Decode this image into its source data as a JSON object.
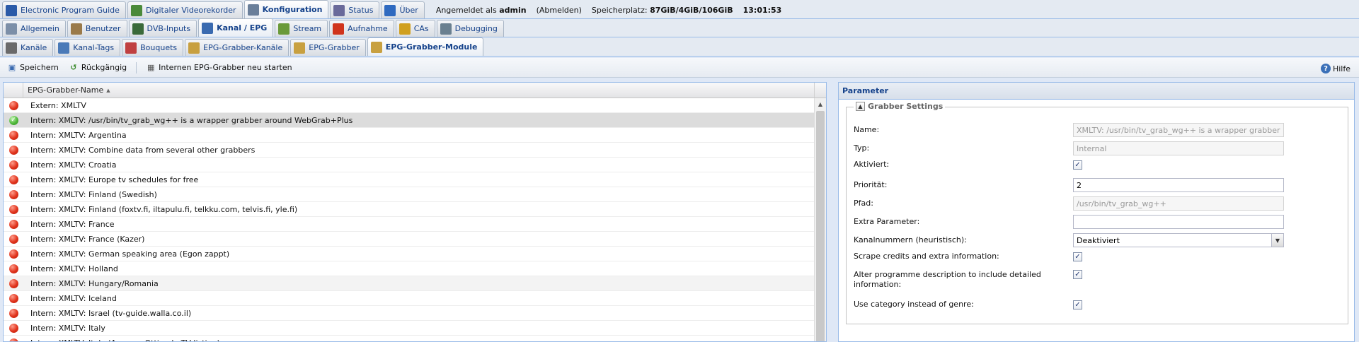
{
  "main_tabs": [
    {
      "label": "Electronic Program Guide",
      "icon": "epg-icon",
      "color": "#2a5aa8",
      "active": false
    },
    {
      "label": "Digitaler Videorekorder",
      "icon": "download-icon",
      "color": "#4a8a3a",
      "active": false
    },
    {
      "label": "Konfiguration",
      "icon": "wrench-icon",
      "color": "#6a7f9a",
      "active": true
    },
    {
      "label": "Status",
      "icon": "eye-icon",
      "color": "#6a6a9a",
      "active": false
    },
    {
      "label": "Über",
      "icon": "info-icon",
      "color": "#2f6ac0",
      "active": false
    }
  ],
  "header_info": {
    "logged_in_label": "Angemeldet als",
    "user": "admin",
    "logout": "(Abmelden)",
    "storage_label": "Speicherplatz:",
    "storage_value": "87GiB/4GiB/106GiB",
    "time": "13:01:53"
  },
  "config_tabs": [
    {
      "label": "Allgemein",
      "icon": "tools-icon",
      "color": "#7c8fa8"
    },
    {
      "label": "Benutzer",
      "icon": "user-icon",
      "color": "#9a7a4a"
    },
    {
      "label": "DVB-Inputs",
      "icon": "tv-card-icon",
      "color": "#3a6a3a"
    },
    {
      "label": "Kanal / EPG",
      "icon": "tv-icon",
      "color": "#3a6ab0",
      "active": true
    },
    {
      "label": "Stream",
      "icon": "stream-icon",
      "color": "#6a9a3a"
    },
    {
      "label": "Aufnahme",
      "icon": "record-icon",
      "color": "#d0341c"
    },
    {
      "label": "CAs",
      "icon": "key-icon",
      "color": "#d0a020"
    },
    {
      "label": "Debugging",
      "icon": "bug-icon",
      "color": "#6a8090"
    }
  ],
  "sub_tabs": [
    {
      "label": "Kanäle",
      "icon": "remote-icon",
      "color": "#6a6a6a"
    },
    {
      "label": "Kanal-Tags",
      "icon": "tags-icon",
      "color": "#4a7ab8"
    },
    {
      "label": "Bouquets",
      "icon": "bouquet-icon",
      "color": "#c04040"
    },
    {
      "label": "EPG-Grabber-Kanäle",
      "icon": "folder-icon",
      "color": "#c8a040"
    },
    {
      "label": "EPG-Grabber",
      "icon": "folder-icon",
      "color": "#c8a040"
    },
    {
      "label": "EPG-Grabber-Module",
      "icon": "folder-icon",
      "color": "#c8a040",
      "active": true
    }
  ],
  "toolbar": {
    "save": "Speichern",
    "undo": "Rückgängig",
    "restart": "Internen EPG-Grabber neu starten",
    "help": "Hilfe"
  },
  "grid": {
    "column": "EPG-Grabber-Name",
    "rows": [
      {
        "name": "Extern: XMLTV",
        "enabled": false
      },
      {
        "name": "Intern: XMLTV: /usr/bin/tv_grab_wg++ is a wrapper grabber around WebGrab+Plus",
        "enabled": true,
        "selected": true
      },
      {
        "name": "Intern: XMLTV: Argentina",
        "enabled": false
      },
      {
        "name": "Intern: XMLTV: Combine data from several other grabbers",
        "enabled": false
      },
      {
        "name": "Intern: XMLTV: Croatia",
        "enabled": false
      },
      {
        "name": "Intern: XMLTV: Europe tv schedules for free",
        "enabled": false
      },
      {
        "name": "Intern: XMLTV: Finland (Swedish)",
        "enabled": false
      },
      {
        "name": "Intern: XMLTV: Finland (foxtv.fi, iltapulu.fi, telkku.com, telvis.fi, yle.fi)",
        "enabled": false
      },
      {
        "name": "Intern: XMLTV: France",
        "enabled": false
      },
      {
        "name": "Intern: XMLTV: France (Kazer)",
        "enabled": false
      },
      {
        "name": "Intern: XMLTV: German speaking area (Egon zappt)",
        "enabled": false
      },
      {
        "name": "Intern: XMLTV: Holland",
        "enabled": false
      },
      {
        "name": "Intern: XMLTV: Hungary/Romania",
        "enabled": false,
        "alt": true
      },
      {
        "name": "Intern: XMLTV: Iceland",
        "enabled": false
      },
      {
        "name": "Intern: XMLTV: Israel (tv-guide.walla.co.il)",
        "enabled": false
      },
      {
        "name": "Intern: XMLTV: Italy",
        "enabled": false
      },
      {
        "name": "Intern: XMLTV: Italy (Accesso Ottimale TV listing)",
        "enabled": false
      }
    ]
  },
  "panel": {
    "title": "Parameter",
    "legend": "Grabber Settings",
    "name_label": "Name:",
    "name_value": "XMLTV: /usr/bin/tv_grab_wg++ is a wrapper grabber",
    "type_label": "Typ:",
    "type_value": "Internal",
    "enabled_label": "Aktiviert:",
    "priority_label": "Priorität:",
    "priority_value": "2",
    "path_label": "Pfad:",
    "path_value": "/usr/bin/tv_grab_wg++",
    "extra_label": "Extra Parameter:",
    "extra_value": "",
    "chnum_label": "Kanalnummern (heuristisch):",
    "chnum_value": "Deaktiviert",
    "scrape_label": "Scrape credits and extra information:",
    "alter_label": "Alter programme description to include detailed information:",
    "category_label": "Use category instead of genre:"
  }
}
